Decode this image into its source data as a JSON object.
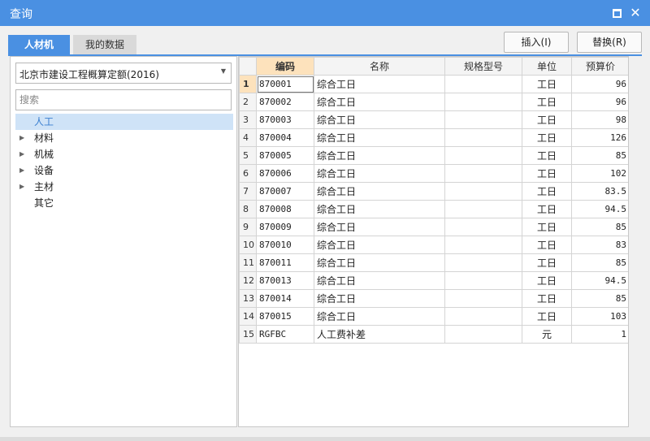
{
  "window": {
    "title": "查询"
  },
  "tabs": [
    {
      "label": "人材机"
    },
    {
      "label": "我的数据"
    }
  ],
  "toolbar": {
    "insert_label": "插入(I)",
    "replace_label": "替换(R)"
  },
  "left": {
    "select_value": "北京市建设工程概算定额(2016)",
    "search_placeholder": "搜索",
    "tree": [
      {
        "label": "人工"
      },
      {
        "label": "材料"
      },
      {
        "label": "机械"
      },
      {
        "label": "设备"
      },
      {
        "label": "主材"
      },
      {
        "label": "其它"
      }
    ]
  },
  "grid": {
    "columns": [
      "编码",
      "名称",
      "规格型号",
      "单位",
      "预算价"
    ],
    "rows": [
      {
        "num": "1",
        "code": "870001",
        "name": "综合工日",
        "spec": "",
        "unit": "工日",
        "price": "96"
      },
      {
        "num": "2",
        "code": "870002",
        "name": "综合工日",
        "spec": "",
        "unit": "工日",
        "price": "96"
      },
      {
        "num": "3",
        "code": "870003",
        "name": "综合工日",
        "spec": "",
        "unit": "工日",
        "price": "98"
      },
      {
        "num": "4",
        "code": "870004",
        "name": "综合工日",
        "spec": "",
        "unit": "工日",
        "price": "126"
      },
      {
        "num": "5",
        "code": "870005",
        "name": "综合工日",
        "spec": "",
        "unit": "工日",
        "price": "85"
      },
      {
        "num": "6",
        "code": "870006",
        "name": "综合工日",
        "spec": "",
        "unit": "工日",
        "price": "102"
      },
      {
        "num": "7",
        "code": "870007",
        "name": "综合工日",
        "spec": "",
        "unit": "工日",
        "price": "83.5"
      },
      {
        "num": "8",
        "code": "870008",
        "name": "综合工日",
        "spec": "",
        "unit": "工日",
        "price": "94.5"
      },
      {
        "num": "9",
        "code": "870009",
        "name": "综合工日",
        "spec": "",
        "unit": "工日",
        "price": "85"
      },
      {
        "num": "10",
        "code": "870010",
        "name": "综合工日",
        "spec": "",
        "unit": "工日",
        "price": "83"
      },
      {
        "num": "11",
        "code": "870011",
        "name": "综合工日",
        "spec": "",
        "unit": "工日",
        "price": "85"
      },
      {
        "num": "12",
        "code": "870013",
        "name": "综合工日",
        "spec": "",
        "unit": "工日",
        "price": "94.5"
      },
      {
        "num": "13",
        "code": "870014",
        "name": "综合工日",
        "spec": "",
        "unit": "工日",
        "price": "85"
      },
      {
        "num": "14",
        "code": "870015",
        "name": "综合工日",
        "spec": "",
        "unit": "工日",
        "price": "103"
      },
      {
        "num": "15",
        "code": "RGFBC",
        "name": "人工费补差",
        "spec": "",
        "unit": "元",
        "price": "1"
      }
    ]
  },
  "colors": {
    "titlebar": "#4a90e2",
    "selected_tree_bg": "#cfe3f7",
    "header_highlight": "#fde2bc"
  }
}
